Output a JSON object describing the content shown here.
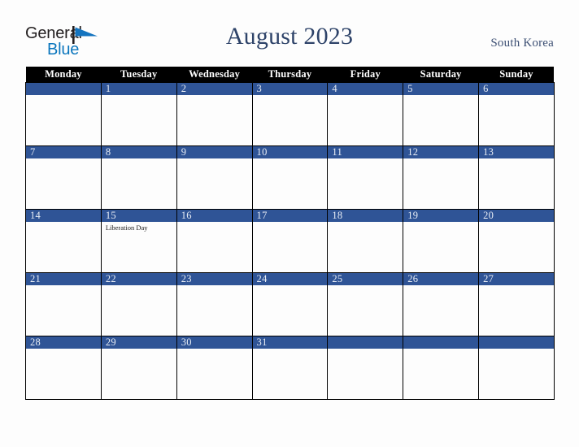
{
  "brand": {
    "name_part1": "General",
    "name_part2": "Blue",
    "mark": "triangle-flag-icon",
    "color_dark": "#231f20",
    "color_blue": "#0b76bd"
  },
  "header": {
    "title": "August 2023",
    "country": "South Korea",
    "title_color": "#2e4369",
    "country_color": "#3c4f73"
  },
  "calendar": {
    "accent_color": "#2f5496",
    "header_bg": "#000000",
    "header_text_color": "#ffffff",
    "weekday_headers": [
      "Monday",
      "Tuesday",
      "Wednesday",
      "Thursday",
      "Friday",
      "Saturday",
      "Sunday"
    ],
    "weeks": [
      [
        {
          "day": "",
          "event": ""
        },
        {
          "day": "1",
          "event": ""
        },
        {
          "day": "2",
          "event": ""
        },
        {
          "day": "3",
          "event": ""
        },
        {
          "day": "4",
          "event": ""
        },
        {
          "day": "5",
          "event": ""
        },
        {
          "day": "6",
          "event": ""
        }
      ],
      [
        {
          "day": "7",
          "event": ""
        },
        {
          "day": "8",
          "event": ""
        },
        {
          "day": "9",
          "event": ""
        },
        {
          "day": "10",
          "event": ""
        },
        {
          "day": "11",
          "event": ""
        },
        {
          "day": "12",
          "event": ""
        },
        {
          "day": "13",
          "event": ""
        }
      ],
      [
        {
          "day": "14",
          "event": ""
        },
        {
          "day": "15",
          "event": "Liberation Day"
        },
        {
          "day": "16",
          "event": ""
        },
        {
          "day": "17",
          "event": ""
        },
        {
          "day": "18",
          "event": ""
        },
        {
          "day": "19",
          "event": ""
        },
        {
          "day": "20",
          "event": ""
        }
      ],
      [
        {
          "day": "21",
          "event": ""
        },
        {
          "day": "22",
          "event": ""
        },
        {
          "day": "23",
          "event": ""
        },
        {
          "day": "24",
          "event": ""
        },
        {
          "day": "25",
          "event": ""
        },
        {
          "day": "26",
          "event": ""
        },
        {
          "day": "27",
          "event": ""
        }
      ],
      [
        {
          "day": "28",
          "event": ""
        },
        {
          "day": "29",
          "event": ""
        },
        {
          "day": "30",
          "event": ""
        },
        {
          "day": "31",
          "event": ""
        },
        {
          "day": "",
          "event": ""
        },
        {
          "day": "",
          "event": ""
        },
        {
          "day": "",
          "event": ""
        }
      ]
    ]
  }
}
